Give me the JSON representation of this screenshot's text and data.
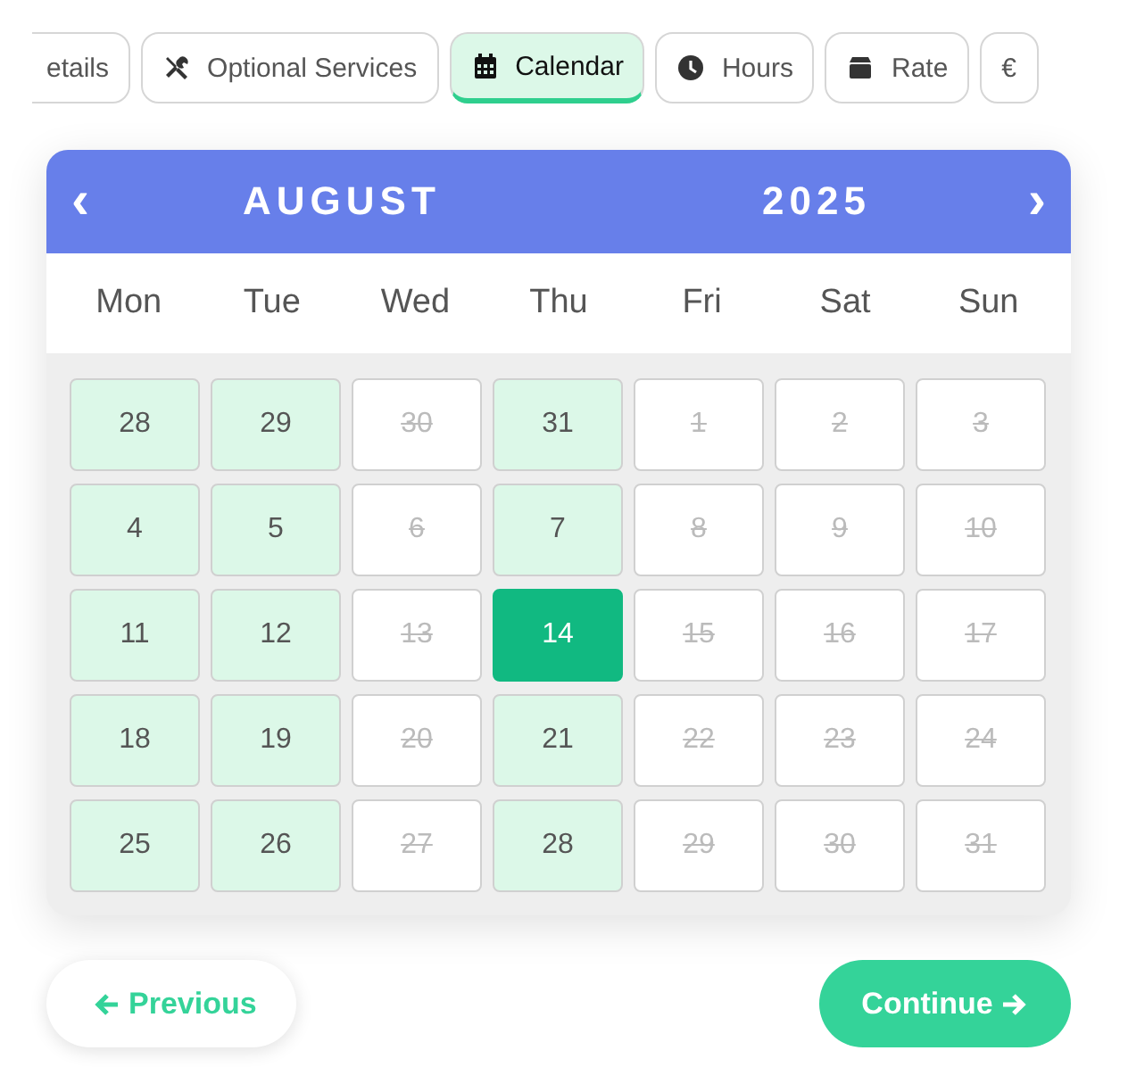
{
  "tabs": [
    {
      "label": "etails",
      "selected": false
    },
    {
      "label": "Optional Services",
      "selected": false
    },
    {
      "label": "Calendar",
      "selected": true
    },
    {
      "label": "Hours",
      "selected": false
    },
    {
      "label": "Rate",
      "selected": false
    },
    {
      "label": "€",
      "selected": false
    }
  ],
  "calendar": {
    "prev": "‹",
    "month": "AUGUST",
    "year": "2025",
    "next": "›",
    "weekdays": [
      "Mon",
      "Tue",
      "Wed",
      "Thu",
      "Fri",
      "Sat",
      "Sun"
    ],
    "days": [
      {
        "label": "28",
        "available": true,
        "selected": false
      },
      {
        "label": "29",
        "available": true,
        "selected": false
      },
      {
        "label": "30",
        "available": false,
        "selected": false
      },
      {
        "label": "31",
        "available": true,
        "selected": false
      },
      {
        "label": "1",
        "available": false,
        "selected": false
      },
      {
        "label": "2",
        "available": false,
        "selected": false
      },
      {
        "label": "3",
        "available": false,
        "selected": false
      },
      {
        "label": "4",
        "available": true,
        "selected": false
      },
      {
        "label": "5",
        "available": true,
        "selected": false
      },
      {
        "label": "6",
        "available": false,
        "selected": false
      },
      {
        "label": "7",
        "available": true,
        "selected": false
      },
      {
        "label": "8",
        "available": false,
        "selected": false
      },
      {
        "label": "9",
        "available": false,
        "selected": false
      },
      {
        "label": "10",
        "available": false,
        "selected": false
      },
      {
        "label": "11",
        "available": true,
        "selected": false
      },
      {
        "label": "12",
        "available": true,
        "selected": false
      },
      {
        "label": "13",
        "available": false,
        "selected": false
      },
      {
        "label": "14",
        "available": true,
        "selected": true
      },
      {
        "label": "15",
        "available": false,
        "selected": false
      },
      {
        "label": "16",
        "available": false,
        "selected": false
      },
      {
        "label": "17",
        "available": false,
        "selected": false
      },
      {
        "label": "18",
        "available": true,
        "selected": false
      },
      {
        "label": "19",
        "available": true,
        "selected": false
      },
      {
        "label": "20",
        "available": false,
        "selected": false
      },
      {
        "label": "21",
        "available": true,
        "selected": false
      },
      {
        "label": "22",
        "available": false,
        "selected": false
      },
      {
        "label": "23",
        "available": false,
        "selected": false
      },
      {
        "label": "24",
        "available": false,
        "selected": false
      },
      {
        "label": "25",
        "available": true,
        "selected": false
      },
      {
        "label": "26",
        "available": true,
        "selected": false
      },
      {
        "label": "27",
        "available": false,
        "selected": false
      },
      {
        "label": "28",
        "available": true,
        "selected": false
      },
      {
        "label": "29",
        "available": false,
        "selected": false
      },
      {
        "label": "30",
        "available": false,
        "selected": false
      },
      {
        "label": "31",
        "available": false,
        "selected": false
      }
    ]
  },
  "buttons": {
    "previous": "Previous",
    "continue": "Continue"
  }
}
